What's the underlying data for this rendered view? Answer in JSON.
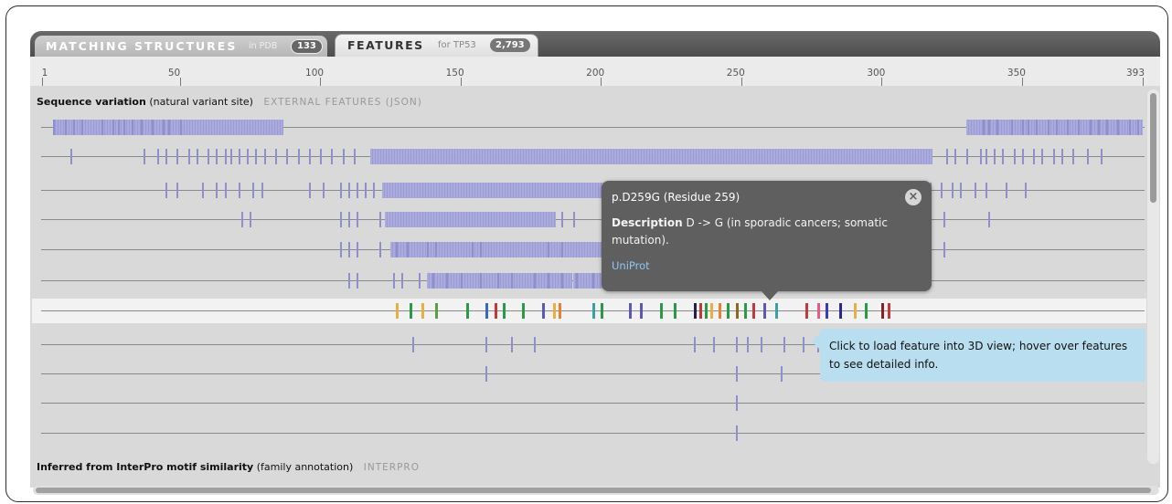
{
  "tabs": {
    "matching": {
      "label": "MATCHING STRUCTURES",
      "sub": "in PDB",
      "count": "133"
    },
    "features": {
      "label": "FEATURES",
      "sub": "for TP53",
      "count": "2,793"
    }
  },
  "ruler": {
    "labels": [
      "1",
      "50",
      "100",
      "150",
      "200",
      "250",
      "300",
      "350",
      "393"
    ],
    "max": 393
  },
  "sections": {
    "variation": {
      "title": "Sequence variation",
      "qualifier": "(natural variant site)",
      "source": "EXTERNAL FEATURES (JSON)"
    },
    "interpro": {
      "title": "Inferred from InterPro motif similarity",
      "qualifier": "(family annotation)",
      "source": "INTERPRO"
    }
  },
  "tooltip": {
    "title": "p.D259G (Residue 259)",
    "description_label": "Description",
    "description_text": "D -> G (in sporadic cancers; somatic mutation).",
    "link": "UniProt",
    "close_glyph": "×"
  },
  "hint": {
    "text": "Click to load feature into 3D view; hover over features to see detailed info."
  },
  "colors": {
    "variant_bar": "#aaaadc",
    "tooltip_bg": "#5f5f5f",
    "hint_bg": "#b8deef",
    "link": "#8ec6f7"
  },
  "tracks": {
    "row1": {
      "dense": [
        [
          5,
          87
        ],
        [
          330,
          393
        ]
      ],
      "ticks": [
        5,
        9,
        12,
        15,
        22,
        26,
        28,
        30,
        33,
        36,
        40,
        44,
        46,
        50,
        336,
        338,
        341,
        346,
        350,
        352,
        355,
        359,
        362,
        366,
        370,
        374,
        377,
        380,
        384,
        388,
        391
      ]
    },
    "row2": {
      "dense": [
        [
          118,
          318
        ]
      ],
      "ticks": [
        11,
        37,
        42,
        45,
        49,
        53,
        56,
        60,
        63,
        66,
        68,
        71,
        74,
        77,
        80,
        84,
        88,
        92,
        96,
        100,
        104,
        108,
        112,
        323,
        326,
        330,
        335,
        337,
        340,
        343,
        347,
        350,
        354,
        357,
        361,
        364,
        368,
        373,
        378
      ]
    },
    "row3": {
      "dense": [
        [
          122,
          213
        ],
        [
          233,
          289
        ]
      ],
      "ticks": [
        45,
        49,
        58,
        63,
        66,
        71,
        76,
        79,
        96,
        101,
        107,
        110,
        113,
        116,
        119,
        317,
        321,
        325,
        328,
        333,
        337,
        344,
        351
      ]
    },
    "row4": {
      "dense": [
        [
          123,
          184
        ],
        [
          233,
          288
        ]
      ],
      "ticks": [
        72,
        75,
        107,
        110,
        113,
        121,
        186,
        190,
        322,
        338
      ]
    },
    "row5": {
      "dense": [
        [
          125,
          210
        ],
        [
          233,
          288
        ]
      ],
      "ticks": [
        107,
        110,
        113,
        121,
        127,
        131,
        138,
        141,
        154,
        157,
        181,
        186,
        322
      ]
    },
    "row6": {
      "dense": [
        [
          138,
          190
        ],
        [
          190,
          213
        ]
      ],
      "ticks": [
        110,
        113,
        126,
        129,
        135,
        140,
        145,
        150,
        157,
        163,
        168,
        176,
        181,
        186,
        191,
        197,
        203,
        208
      ]
    },
    "row7": {
      "colored": [
        [
          127,
          "#e8b040"
        ],
        [
          132,
          "#2a9a4a"
        ],
        [
          136,
          "#e8b040"
        ],
        [
          141,
          "#5aa040"
        ],
        [
          152,
          "#2a9a4a"
        ],
        [
          159,
          "#3a66c4"
        ],
        [
          162,
          "#c03a3a"
        ],
        [
          165,
          "#2a9a4a"
        ],
        [
          172,
          "#2a9a4a"
        ],
        [
          179,
          "#5a5ab0"
        ],
        [
          183,
          "#e8b040"
        ],
        [
          185,
          "#e88030"
        ],
        [
          197,
          "#3aa0a0"
        ],
        [
          200,
          "#2a9a4a"
        ],
        [
          210,
          "#5a5ab0"
        ],
        [
          214,
          "#5a5ab0"
        ],
        [
          221,
          "#2a9a4a"
        ],
        [
          226,
          "#2a9a4a"
        ],
        [
          233,
          "#222244"
        ],
        [
          235,
          "#c03a3a"
        ],
        [
          237,
          "#2a9a4a"
        ],
        [
          239,
          "#e8b040"
        ],
        [
          242,
          "#e88030"
        ],
        [
          245,
          "#2a9a4a"
        ],
        [
          248,
          "#8a6a20"
        ],
        [
          251,
          "#2a9a4a"
        ],
        [
          254,
          "#c03a3a"
        ],
        [
          258,
          "#5a5ab0"
        ],
        [
          262,
          "#3aa0a0"
        ],
        [
          273,
          "#c03a3a"
        ],
        [
          277,
          "#e85a8a"
        ],
        [
          280,
          "#3a3ab4"
        ],
        [
          285,
          "#2a2a8a"
        ],
        [
          290,
          "#e8b040"
        ],
        [
          294,
          "#2a9a4a"
        ],
        [
          300,
          "#8a2020"
        ],
        [
          302,
          "#c03a3a"
        ]
      ]
    },
    "row8": {
      "ticks": [
        133,
        159,
        168,
        176,
        233,
        240,
        248,
        252,
        257,
        265,
        272,
        277
      ]
    },
    "row9": {
      "ticks": [
        159,
        248,
        264
      ]
    },
    "row10": {
      "ticks": [
        248
      ]
    },
    "row11": {
      "ticks": [
        248
      ]
    }
  }
}
